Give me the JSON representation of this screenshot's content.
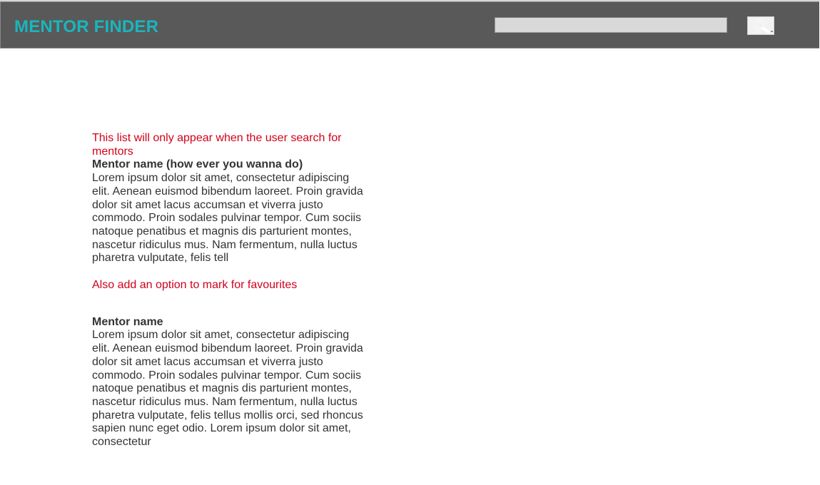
{
  "header": {
    "logo": "MENTOR FINDER",
    "search": {
      "value": "",
      "placeholder": "",
      "button_icon": "search-icon"
    },
    "colors": {
      "header_bg": "#595959",
      "logo": "#19b6bd",
      "note": "#d0021b"
    }
  },
  "main": {
    "list_note": "This list will only appear when the user search for mentors",
    "favourites_note": "Also add an option to mark for favourites",
    "mentors": [
      {
        "name": "Mentor name (how ever you wanna do)",
        "description": "Lorem ipsum dolor sit amet, consectetur adipiscing elit. Aenean euismod bibendum laoreet. Proin gravida dolor sit amet lacus accumsan et viverra justo commodo. Proin sodales pulvinar tempor. Cum sociis natoque penatibus et magnis dis parturient montes, nascetur ridiculus mus. Nam fermentum, nulla luctus pharetra vulputate, felis tell"
      },
      {
        "name": "Mentor name",
        "description": "Lorem ipsum dolor sit amet, consectetur adipiscing elit. Aenean euismod bibendum laoreet. Proin gravida dolor sit amet lacus accumsan et viverra justo commodo. Proin sodales pulvinar tempor. Cum sociis natoque penatibus et magnis dis parturient montes, nascetur ridiculus mus. Nam fermentum, nulla luctus pharetra vulputate, felis tellus mollis orci, sed rhoncus sapien nunc eget odio. Lorem ipsum dolor sit amet, consectetur"
      }
    ]
  }
}
